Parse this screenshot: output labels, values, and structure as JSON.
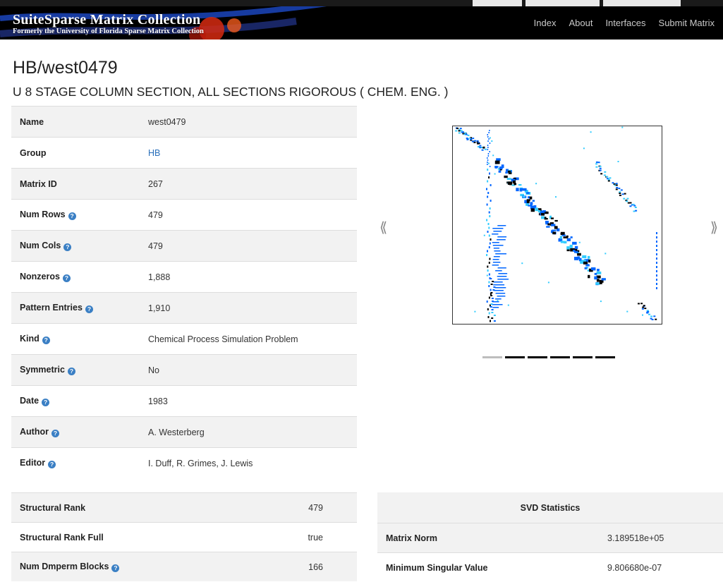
{
  "header": {
    "title": "SuiteSparse Matrix Collection",
    "subtitle": "Formerly the University of Florida Sparse Matrix Collection",
    "nav": [
      "Index",
      "About",
      "Interfaces",
      "Submit Matrix"
    ]
  },
  "page": {
    "title": "HB/west0479",
    "subtitle": "U 8 STAGE COLUMN SECTION, ALL SECTIONS RIGOROUS ( CHEM. ENG. )"
  },
  "info": [
    {
      "label": "Name",
      "value": "west0479",
      "help": false,
      "link": false
    },
    {
      "label": "Group",
      "value": "HB",
      "help": false,
      "link": true
    },
    {
      "label": "Matrix ID",
      "value": "267",
      "help": false,
      "link": false
    },
    {
      "label": "Num Rows",
      "value": "479",
      "help": true,
      "link": false
    },
    {
      "label": "Num Cols",
      "value": "479",
      "help": true,
      "link": false
    },
    {
      "label": "Nonzeros",
      "value": "1,888",
      "help": true,
      "link": false
    },
    {
      "label": "Pattern Entries",
      "value": "1,910",
      "help": true,
      "link": false
    },
    {
      "label": "Kind",
      "value": "Chemical Process Simulation Problem",
      "help": true,
      "link": false
    },
    {
      "label": "Symmetric",
      "value": "No",
      "help": true,
      "link": false
    },
    {
      "label": "Date",
      "value": "1983",
      "help": true,
      "link": false
    },
    {
      "label": "Author",
      "value": "A. Westerberg",
      "help": true,
      "link": false
    },
    {
      "label": "Editor",
      "value": "I. Duff, R. Grimes, J. Lewis",
      "help": true,
      "link": false
    }
  ],
  "carousel": {
    "prev_icon": "chevron-left-icon",
    "next_icon": "chevron-right-icon",
    "indicator_count": 6,
    "active_index": 0,
    "colors": {
      "dense": "#000000",
      "mid": "#0066ff",
      "light": "#33ccff"
    }
  },
  "rank": [
    {
      "label": "Structural Rank",
      "value": "479",
      "help": false
    },
    {
      "label": "Structural Rank Full",
      "value": "true",
      "help": false
    },
    {
      "label": "Num Dmperm Blocks",
      "value": "166",
      "help": true
    }
  ],
  "svd": {
    "heading": "SVD Statistics",
    "rows": [
      {
        "label": "Matrix Norm",
        "value": "3.189518e+05"
      },
      {
        "label": "Minimum Singular Value",
        "value": "9.806680e-07"
      }
    ]
  }
}
